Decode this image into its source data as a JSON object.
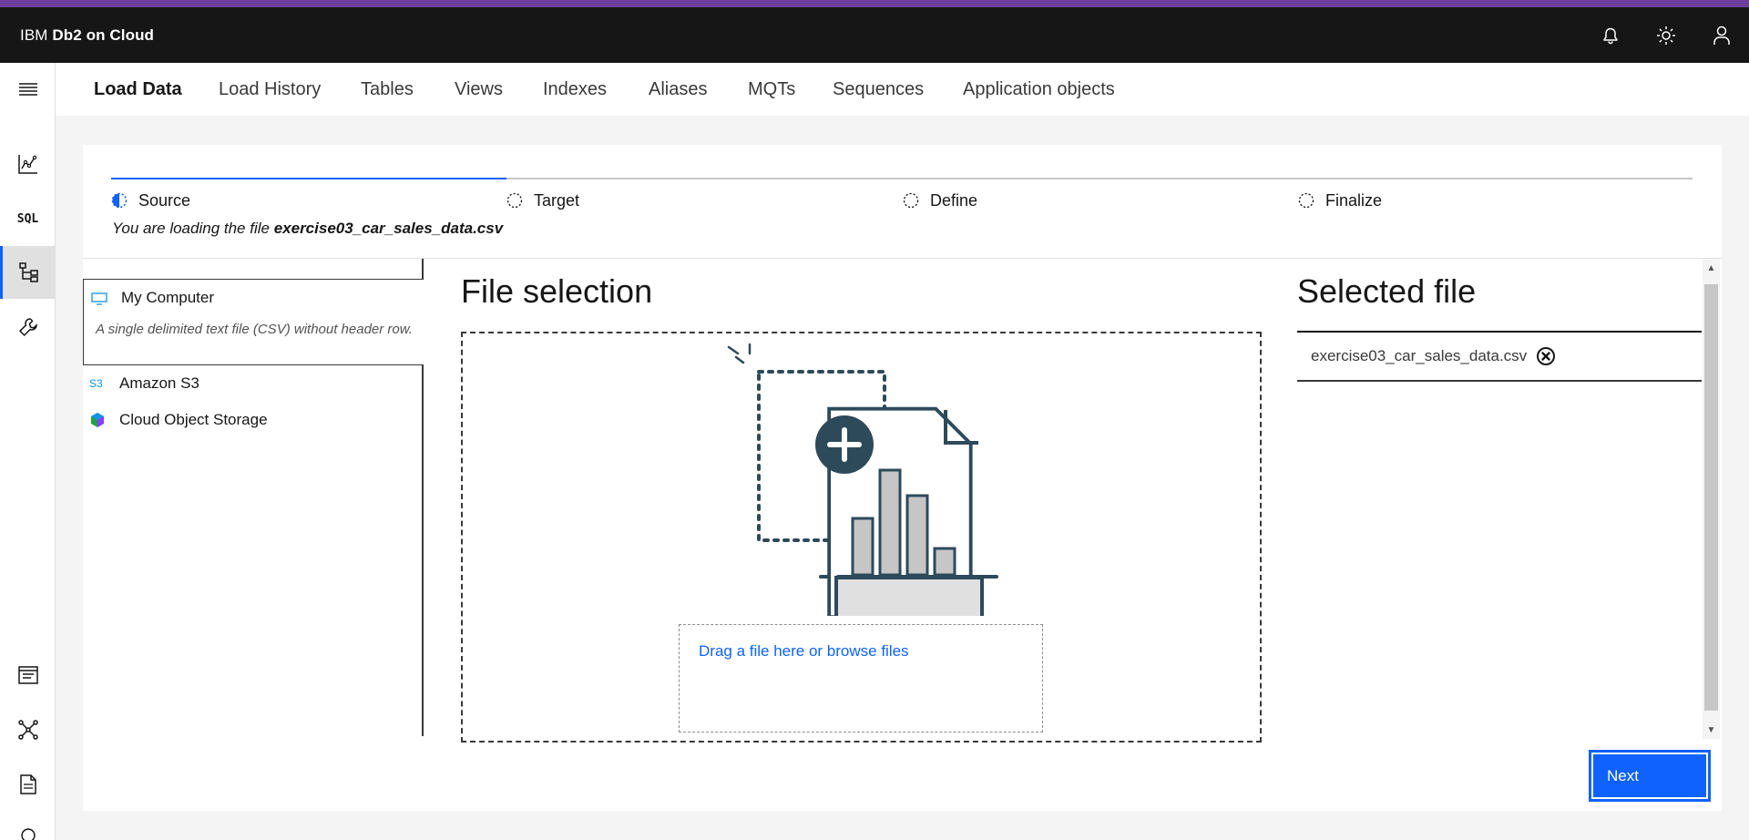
{
  "colors": {
    "accent_strip": "#6f3f9e",
    "topbar": "#161616",
    "primary": "#0f62fe"
  },
  "header": {
    "brand_prefix": "IBM",
    "brand_name": "Db2 on Cloud",
    "icons": [
      "notification-icon",
      "theme-toggle-icon",
      "user-profile-icon"
    ]
  },
  "left_rail": {
    "menu_icon": "hamburger-menu-icon",
    "items": [
      "monitor-icon",
      "SQL",
      "data-tree-icon",
      "tools-icon"
    ],
    "bottom_items": [
      "notes-icon",
      "network-icon",
      "document-icon",
      "idea-icon"
    ],
    "active_index": 2
  },
  "tabs": [
    {
      "label": "Load Data",
      "active": true
    },
    {
      "label": "Load History"
    },
    {
      "label": "Tables"
    },
    {
      "label": "Views"
    },
    {
      "label": "Indexes"
    },
    {
      "label": "Aliases"
    },
    {
      "label": "MQTs"
    },
    {
      "label": "Sequences"
    },
    {
      "label": "Application objects"
    }
  ],
  "steps": [
    {
      "label": "Source",
      "state": "current"
    },
    {
      "label": "Target",
      "state": "pending"
    },
    {
      "label": "Define",
      "state": "pending"
    },
    {
      "label": "Finalize",
      "state": "pending"
    }
  ],
  "progress_fraction": 0.25,
  "loading_message": {
    "prefix": "You are loading the file",
    "file": "exercise03_car_sales_data.csv"
  },
  "sources": [
    {
      "label": "My Computer",
      "icon": "computer-icon",
      "selected": true,
      "description": "A single delimited text file (CSV) without header row."
    },
    {
      "label": "Amazon S3",
      "icon": "s3-icon",
      "icon_text": "S3"
    },
    {
      "label": "Cloud Object Storage",
      "icon": "cloud-object-storage-icon"
    }
  ],
  "file_selection": {
    "title": "File selection",
    "browse_text": "Drag a file here or browse files",
    "illustration": "file-upload-illustration"
  },
  "selected_file": {
    "title": "Selected file",
    "file_name": "exercise03_car_sales_data.csv",
    "remove_icon": "close-circle-icon"
  },
  "actions": {
    "next_label": "Next"
  }
}
